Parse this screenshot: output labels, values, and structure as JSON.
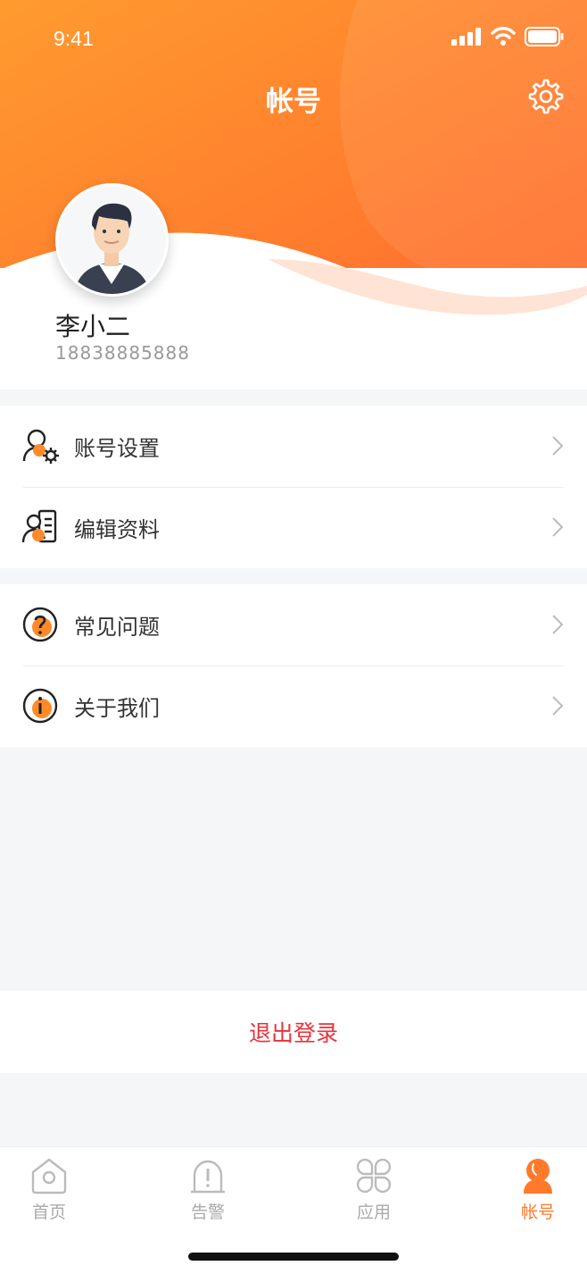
{
  "status": {
    "time": "9:41"
  },
  "header": {
    "title": "帐号"
  },
  "profile": {
    "name": "李小二",
    "phone": "18838885888"
  },
  "menu_group_1": [
    {
      "label": "账号设置",
      "icon": "user-settings-icon"
    },
    {
      "label": "编辑资料",
      "icon": "edit-profile-icon"
    }
  ],
  "menu_group_2": [
    {
      "label": "常见问题",
      "icon": "question-icon"
    },
    {
      "label": "关于我们",
      "icon": "info-icon"
    }
  ],
  "logout": {
    "label": "退出登录"
  },
  "tabs": [
    {
      "label": "首页",
      "icon": "home-icon"
    },
    {
      "label": "告警",
      "icon": "alarm-icon"
    },
    {
      "label": "应用",
      "icon": "apps-icon"
    },
    {
      "label": "帐号",
      "icon": "account-icon",
      "active": true
    }
  ],
  "colors": {
    "accent": "#ff7a2a",
    "gradient_start": "#ff9a2e",
    "gradient_end": "#ff6a2e",
    "logout": "#e8323c"
  }
}
